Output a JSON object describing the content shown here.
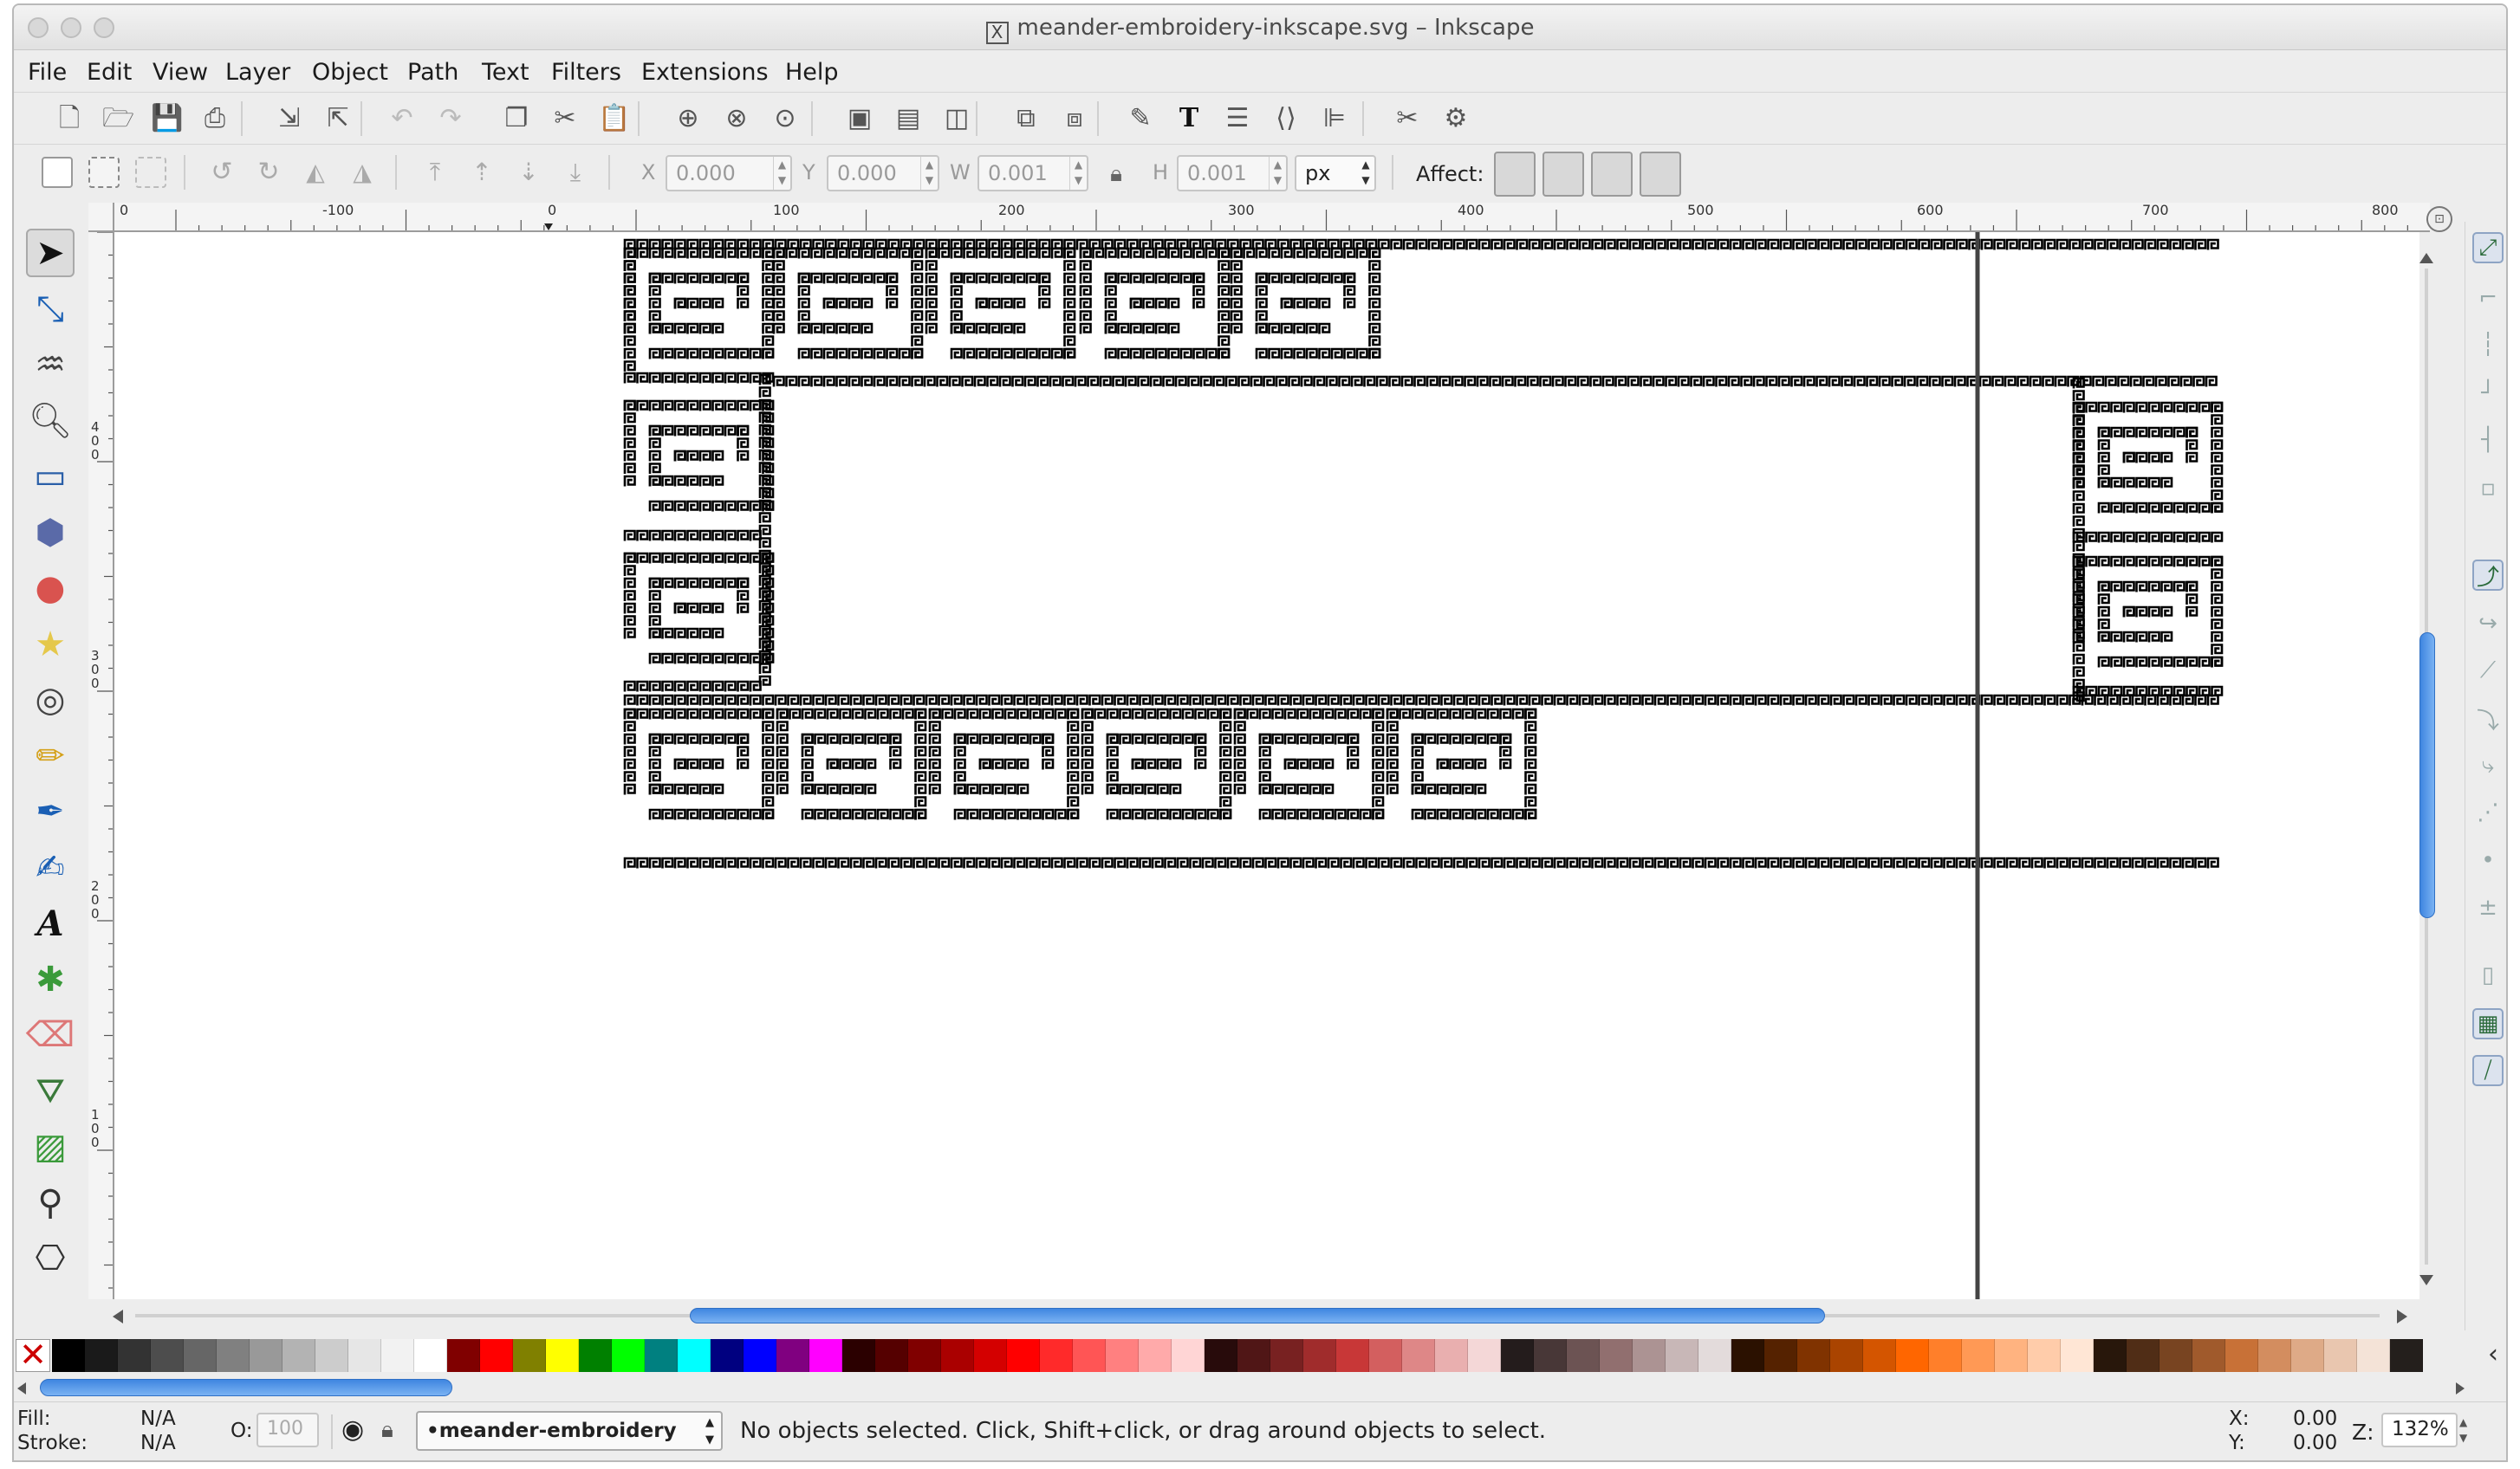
{
  "window": {
    "title": "meander-embroidery-inkscape.svg – Inkscape",
    "title_icon": "X"
  },
  "menubar": {
    "items": [
      {
        "label": "File"
      },
      {
        "label": "Edit"
      },
      {
        "label": "View"
      },
      {
        "label": "Layer"
      },
      {
        "label": "Object"
      },
      {
        "label": "Path"
      },
      {
        "label": "Text"
      },
      {
        "label": "Filters"
      },
      {
        "label": "Extensions"
      },
      {
        "label": "Help"
      }
    ]
  },
  "command_bar": {
    "icons": [
      "new-document-icon",
      "open-icon",
      "save-icon",
      "print-icon",
      "import-icon",
      "export-icon",
      "undo-icon",
      "redo-icon",
      "duplicate-icon",
      "cut-icon",
      "paste-icon",
      "zoom-selection-icon",
      "zoom-drawing-icon",
      "zoom-page-icon",
      "group-icon",
      "ungroup-icon",
      "clone-icon",
      "link-icon",
      "unlink-icon",
      "node-editor-icon",
      "text-tool-icon",
      "layers-icon",
      "xml-editor-icon",
      "align-icon",
      "preferences-icon",
      "document-properties-icon"
    ]
  },
  "tool_controls": {
    "x_label": "X",
    "x_value": "0.000",
    "y_label": "Y",
    "y_value": "0.000",
    "w_label": "W",
    "w_value": "0.001",
    "h_label": "H",
    "h_value": "0.001",
    "unit": "px",
    "affect_label": "Affect:"
  },
  "ruler": {
    "h_labels": [
      "0",
      "-100",
      "0",
      "100",
      "200",
      "300",
      "400",
      "500",
      "600",
      "700",
      "800"
    ],
    "v_labels": [
      "4\n0\n0",
      "3\n0\n0",
      "2\n0\n0",
      "1\n0\n0"
    ]
  },
  "palette": {
    "colors": [
      "#000000",
      "#1a1a1a",
      "#333333",
      "#4d4d4d",
      "#666666",
      "#808080",
      "#999999",
      "#b3b3b3",
      "#cccccc",
      "#e6e6e6",
      "#f2f2f2",
      "#ffffff",
      "#800000",
      "#ff0000",
      "#808000",
      "#ffff00",
      "#008000",
      "#00ff00",
      "#008080",
      "#00ffff",
      "#000080",
      "#0000ff",
      "#800080",
      "#ff00ff",
      "#2b0000",
      "#550000",
      "#800000",
      "#aa0000",
      "#d40000",
      "#ff0000",
      "#ff2a2a",
      "#ff5555",
      "#ff8080",
      "#ffaaaa",
      "#ffd5d5",
      "#280b0b",
      "#501616",
      "#782121",
      "#a02c2c",
      "#c83737",
      "#d35f5f",
      "#de8787",
      "#e9afaf",
      "#f4d7d7",
      "#241c1c",
      "#483737",
      "#6c5353",
      "#916f6f",
      "#ac9393",
      "#c8b7b7",
      "#e3dbdb",
      "#2b1100",
      "#552200",
      "#803300",
      "#aa4400",
      "#d45500",
      "#ff6600",
      "#ff7f2a",
      "#ff9955",
      "#ffb380",
      "#ffccaa",
      "#ffe6d5",
      "#28170b",
      "#502d16",
      "#784421",
      "#a05a2c",
      "#c87137",
      "#d38d5f",
      "#deaa87",
      "#e9c6af",
      "#f4e3d7",
      "#241f1c"
    ]
  },
  "status": {
    "fill_label": "Fill:",
    "fill_value": "N/A",
    "stroke_label": "Stroke:",
    "stroke_value": "N/A",
    "opacity_label": "O:",
    "opacity_value": "100",
    "layer_name": "•meander-embroidery",
    "message": "No objects selected. Click, Shift+click, or drag around objects to select.",
    "x_label": "X:",
    "x_value": "0.00",
    "y_label": "Y:",
    "y_value": "0.00",
    "zoom_label": "Z:",
    "zoom_value": "132%"
  }
}
